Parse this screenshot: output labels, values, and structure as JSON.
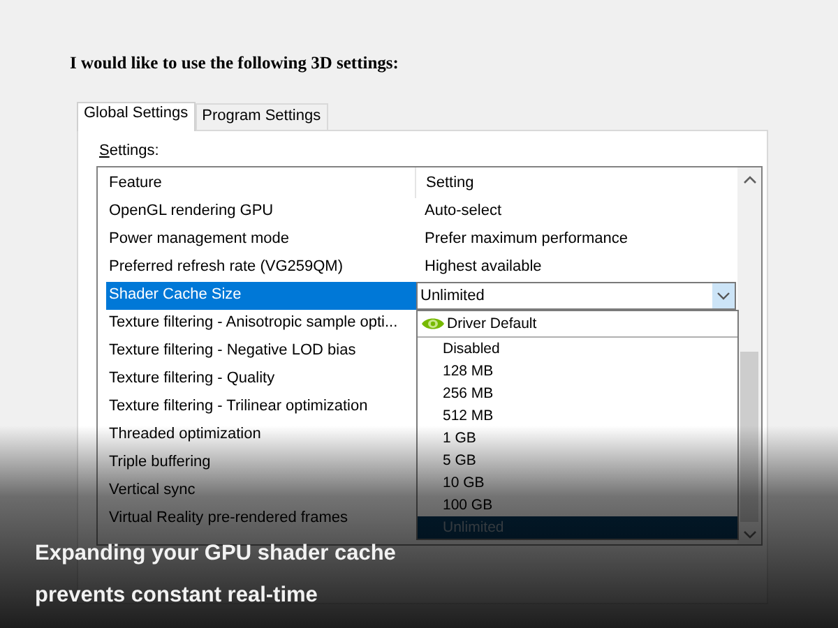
{
  "heading": "I would like to use the following 3D settings:",
  "tabs": [
    {
      "label": "Global Settings",
      "selected": true
    },
    {
      "label": "Program Settings",
      "selected": false
    }
  ],
  "settings_label": "Settings:",
  "table": {
    "columns": [
      "Feature",
      "Setting"
    ],
    "rows": [
      {
        "feature": "OpenGL rendering GPU",
        "setting": "Auto-select",
        "selected": false
      },
      {
        "feature": "Power management mode",
        "setting": "Prefer maximum performance",
        "selected": false
      },
      {
        "feature": "Preferred refresh rate (VG259QM)",
        "setting": "Highest available",
        "selected": false
      },
      {
        "feature": "Shader Cache Size",
        "setting": "Unlimited",
        "selected": true
      },
      {
        "feature": "Texture filtering - Anisotropic sample opti...",
        "selected": false
      },
      {
        "feature": "Texture filtering - Negative LOD bias",
        "selected": false
      },
      {
        "feature": "Texture filtering - Quality",
        "selected": false
      },
      {
        "feature": "Texture filtering - Trilinear optimization",
        "selected": false
      },
      {
        "feature": "Threaded optimization",
        "selected": false
      },
      {
        "feature": "Triple buffering",
        "selected": false
      },
      {
        "feature": "Vertical sync",
        "selected": false
      },
      {
        "feature": "Virtual Reality pre-rendered frames",
        "selected": false
      }
    ]
  },
  "dropdown": {
    "options": [
      {
        "label": "Driver Default",
        "kind": "default",
        "selected": false
      },
      {
        "label": "Disabled",
        "kind": "plain",
        "selected": false
      },
      {
        "label": "128 MB",
        "kind": "plain",
        "selected": false
      },
      {
        "label": "256 MB",
        "kind": "plain",
        "selected": false
      },
      {
        "label": "512 MB",
        "kind": "plain",
        "selected": false
      },
      {
        "label": "1 GB",
        "kind": "plain",
        "selected": false
      },
      {
        "label": "5 GB",
        "kind": "plain",
        "selected": false
      },
      {
        "label": "10 GB",
        "kind": "plain",
        "selected": false
      },
      {
        "label": "100 GB",
        "kind": "plain",
        "selected": false
      },
      {
        "label": "Unlimited",
        "kind": "plain",
        "selected": true
      }
    ]
  },
  "caption": [
    "Expanding your GPU shader cache",
    "prevents constant real-time"
  ]
}
